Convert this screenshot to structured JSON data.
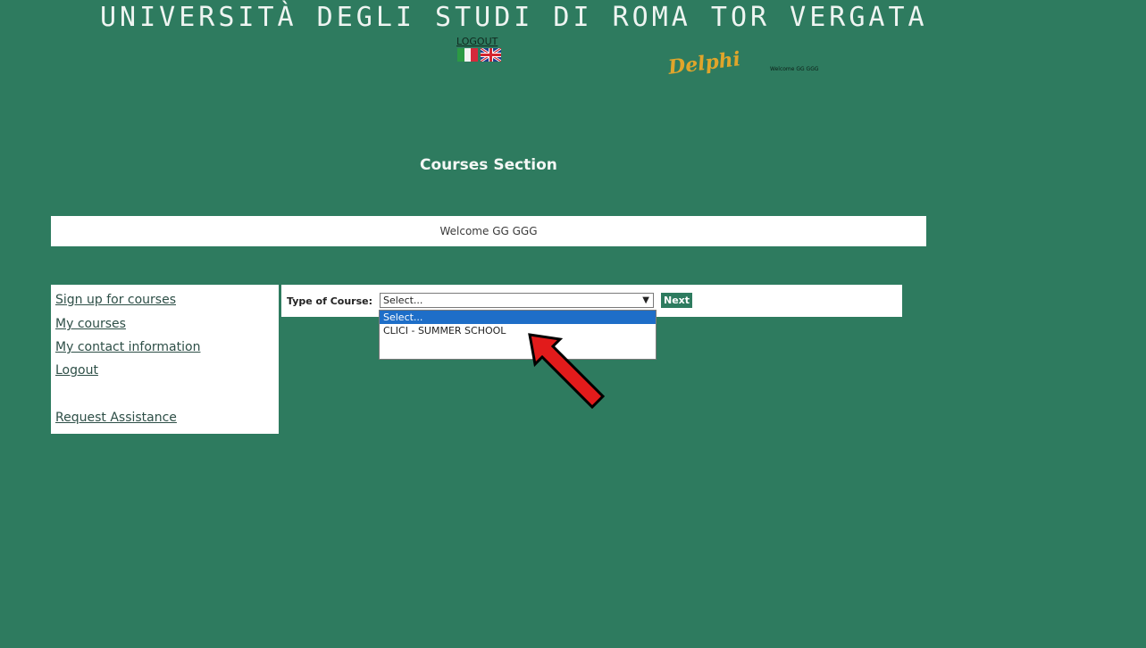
{
  "header": {
    "university": "UNIVERSITÀ DEGLI STUDI DI ROMA TOR VERGATA",
    "logout_label": "LOGOUT",
    "brand": "Delphi"
  },
  "page": {
    "section_title": "Courses Section",
    "welcome": "Welcome GG GGG"
  },
  "sidebar": {
    "items": [
      {
        "label": "Sign up for courses"
      },
      {
        "label": "My courses"
      },
      {
        "label": "My contact information"
      },
      {
        "label": "Logout"
      },
      {
        "label": "Request Assistance"
      }
    ]
  },
  "form": {
    "type_label": "Type of Course:",
    "selected_value": "Select...",
    "next_label": "Next",
    "options": [
      "Select...",
      "CLICI - SUMMER SCHOOL"
    ]
  },
  "colors": {
    "background": "#2e7b5f",
    "brand": "#e0a52b",
    "highlight": "#1e6ec8",
    "annotation_arrow": "#e21b1b"
  },
  "icons": [
    "italian-flag-icon",
    "uk-flag-icon",
    "red-arrow-icon",
    "chevron-down-icon"
  ]
}
